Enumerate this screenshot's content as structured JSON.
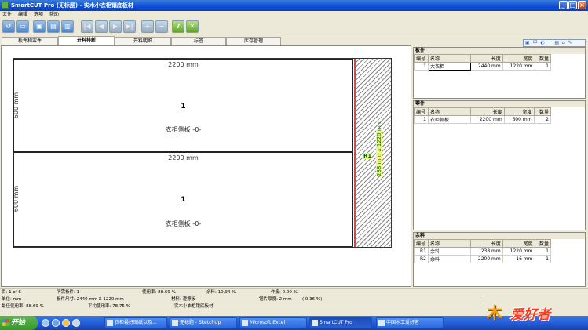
{
  "window": {
    "title": "SmartCUT Pro (无标题) - 实木小衣柜镶底板材",
    "buttons": [
      "_",
      "□",
      "×"
    ]
  },
  "menu": [
    "文件",
    "编辑",
    "选项",
    "帮助"
  ],
  "toolbar": {
    "help_label": "?"
  },
  "tabs": [
    {
      "label": "板件和零件"
    },
    {
      "label": "开料排新"
    },
    {
      "label": "开料明细"
    },
    {
      "label": "标签"
    },
    {
      "label": "库存管理"
    }
  ],
  "canvas": {
    "parts": [
      {
        "width_label": "2200 mm",
        "height_label": "600 mm",
        "number": "1",
        "name": "衣柜侧板 -0-"
      },
      {
        "width_label": "2200 mm",
        "height_label": "600 mm",
        "number": "1",
        "name": "衣柜侧板 -0-"
      }
    ],
    "remnant": {
      "id": "R1",
      "dims": "238 mm x 1220 mm"
    }
  },
  "panels": {
    "boards": {
      "title": "板件",
      "columns": [
        "编号",
        "名称",
        "长度",
        "宽度",
        "数量"
      ],
      "rows": [
        [
          "1",
          "大衣柜",
          "2440 mm",
          "1220 mm",
          "1"
        ]
      ]
    },
    "parts": {
      "title": "零件",
      "columns": [
        "编号",
        "名称",
        "长度",
        "宽度",
        "数量"
      ],
      "rows": [
        [
          "1",
          "衣柜侧板",
          "2200 mm",
          "600 mm",
          "2"
        ]
      ]
    },
    "remnants": {
      "title": "余料",
      "columns": [
        "编号",
        "名称",
        "长度",
        "宽度",
        "数量"
      ],
      "rows": [
        [
          "R1",
          "余料",
          "238 mm",
          "1220 mm",
          "1"
        ],
        [
          "R2",
          "余料",
          "2200 mm",
          "16 mm",
          "1"
        ]
      ]
    }
  },
  "status1": {
    "page": "页: 1 of 6",
    "boards_needed": "所需板件: 1",
    "usage": "使用率: 88.69 %",
    "remnant": "余料: 10.94 %",
    "waste": "作废: 0.00 %"
  },
  "status2": {
    "unit": "单位: mm",
    "board_size": "板件尺寸: 2440 mm X 1220 mm",
    "material": "材料: 澄擦板",
    "kerf": "锯片厚度: 2 mm",
    "kerf_pct": "( 0.36 %)"
  },
  "status3": {
    "best": "最佳使用率: 88.69 %",
    "avg": "平均使用率: 78.75 %",
    "project": "实木小衣柜镶底板材"
  },
  "taskbar": {
    "start": "开始",
    "tasks": [
      {
        "label": "衣柜最好图纸以及..."
      },
      {
        "label": "无标题 - SketchUp"
      },
      {
        "label": "Microsoft Excel"
      },
      {
        "label": "SmartCUT Pro"
      },
      {
        "label": "中国木工爱好者"
      }
    ]
  },
  "logo": {
    "mark": "木",
    "text": "爱好者"
  }
}
